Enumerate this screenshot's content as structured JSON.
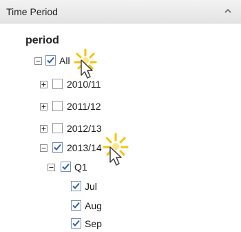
{
  "panel": {
    "header_title": "Time Period",
    "field_title": "period"
  },
  "tree": {
    "all": "All",
    "y2010": "2010/11",
    "y2011": "2011/12",
    "y2012": "2012/13",
    "y2013": "2013/14",
    "q1": "Q1",
    "jul": "Jul",
    "aug": "Aug",
    "sep": "Sep"
  },
  "icons": {
    "collapse": "chevron-up-icon",
    "expander_plus": "plus-box-icon",
    "expander_minus": "minus-box-icon",
    "checkbox": "checkbox-icon",
    "cursor": "mouse-pointer-icon",
    "highlight": "click-burst-icon"
  },
  "colors": {
    "check": "#2d5fb3",
    "burst": "#f5c400"
  }
}
